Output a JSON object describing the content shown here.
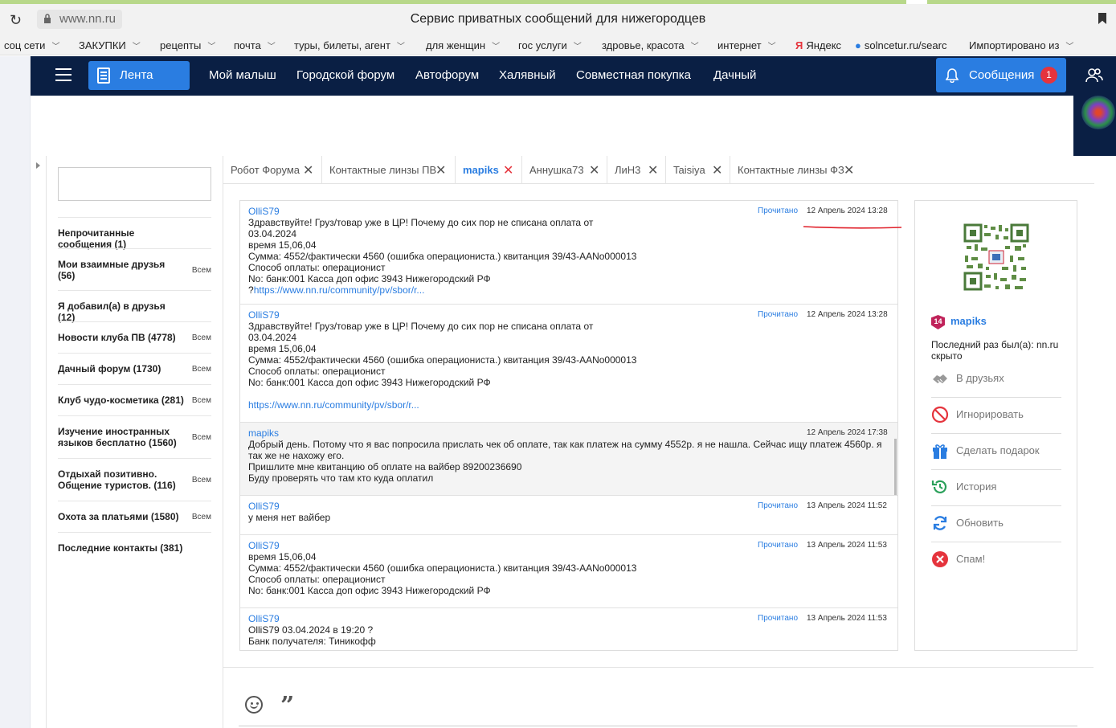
{
  "browser": {
    "url": "www.nn.ru",
    "title": "Сервис приватных сообщений для нижегородцев",
    "bookmarks": [
      {
        "label": "соц сети"
      },
      {
        "label": "ЗАКУПКИ"
      },
      {
        "label": "рецепты"
      },
      {
        "label": "почта"
      },
      {
        "label": "туры, билеты, агент"
      },
      {
        "label": "для женщин"
      },
      {
        "label": "гос услуги"
      },
      {
        "label": "здровье, красота"
      },
      {
        "label": "интернет"
      },
      {
        "label": "Яндекс"
      },
      {
        "label": "solncetur.ru/searc"
      },
      {
        "label": "Импортировано из"
      }
    ]
  },
  "nav": {
    "lenta": "Лента",
    "links": [
      "Мой малыш",
      "Городской форум",
      "Автофорум",
      "Халявный",
      "Совместная покупка",
      "Дачный"
    ],
    "messages_label": "Сообщения",
    "messages_count": "1"
  },
  "sidebar": {
    "search_placeholder": "",
    "items": [
      {
        "label": "Непрочитанные сообщения (1)",
        "all": ""
      },
      {
        "label": "Мои взаимные друзья (56)",
        "all": "Всем"
      },
      {
        "label": "Я добавил(а) в друзья (12)",
        "all": ""
      },
      {
        "label": "Новости клуба ПВ (4778)",
        "all": "Всем"
      },
      {
        "label": "Дачный форум (1730)",
        "all": "Всем"
      },
      {
        "label": "Клуб чудо-косметика (281)",
        "all": "Всем"
      },
      {
        "label": "Изучение иностранных языков бесплатно (1560)",
        "all": "Всем"
      },
      {
        "label": "Отдыхай позитивно. Общение туристов. (116)",
        "all": "Всем"
      },
      {
        "label": "Охота за платьями (1580)",
        "all": "Всем"
      },
      {
        "label": "Последние контакты (381)",
        "all": ""
      }
    ]
  },
  "tabs": [
    {
      "label": "Робот Форума"
    },
    {
      "label": "Контактные линзы ПВ"
    },
    {
      "label": "mapiks"
    },
    {
      "label": "Аннушка73"
    },
    {
      "label": "ЛиН3"
    },
    {
      "label": "Taisiya"
    },
    {
      "label": "Контактные линзы ФЗ"
    }
  ],
  "messages": [
    {
      "author": "OlliS79",
      "status": "Прочитано",
      "date": "12 Апрель 2024 13:28",
      "lines": [
        "Здравствуйте! Груз/товар уже в ЦР! Почему до сих пор не списана оплата от",
        "03.04.2024",
        "время 15,06,04",
        "Сумма: 4552/фактически 4560 (ошибка операциониста.) квитанция 39/43-AANo000013",
        "Способ оплаты: операционист",
        "No: банк:001 Касса доп офис 3943 Нижегородский РФ"
      ],
      "link_prefix": "?",
      "link": "https://www.nn.ru/community/pv/sbor/r..."
    },
    {
      "author": "OlliS79",
      "status": "Прочитано",
      "date": "12 Апрель 2024 13:28",
      "lines": [
        "Здравствуйте! Груз/товар уже в ЦР! Почему до сих пор не списана оплата от",
        "03.04.2024",
        "время 15,06,04",
        "Сумма: 4552/фактически 4560 (ошибка операциониста.) квитанция 39/43-AANo000013",
        "Способ оплаты: операционист",
        "No: банк:001 Касса доп офис 3943 Нижегородский РФ",
        ""
      ],
      "link_prefix": "",
      "link": "https://www.nn.ru/community/pv/sbor/r..."
    },
    {
      "author": "mapiks",
      "status": "",
      "date": "12 Апрель 2024 17:38",
      "lines": [
        "Добрый день. Потому что я вас попросила прислать чек об оплате, так как платеж на сумму 4552р. я не нашла. Сейчас ищу платеж 4560р. я так же не нахожу его.",
        "Пришлите мне квитанцию об оплате на вайбер 89200236690",
        "Буду проверять что там кто куда оплатил"
      ],
      "link_prefix": "",
      "link": ""
    },
    {
      "author": "OlliS79",
      "status": "Прочитано",
      "date": "13 Апрель 2024 11:52",
      "lines": [
        "у меня нет вайбер"
      ],
      "link_prefix": "",
      "link": ""
    },
    {
      "author": "OlliS79",
      "status": "Прочитано",
      "date": "13 Апрель 2024 11:53",
      "lines": [
        "время 15,06,04",
        "Сумма: 4552/фактически 4560 (ошибка операциониста.) квитанция 39/43-AANo000013",
        "Способ оплаты: операционист",
        "No: банк:001 Касса доп офис 3943 Нижегородский РФ"
      ],
      "link_prefix": "",
      "link": ""
    },
    {
      "author": "OlliS79",
      "status": "Прочитано",
      "date": "13 Апрель 2024 11:53",
      "lines": [
        "OlliS79 03.04.2024 в 19:20 ?",
        "Банк получателя: Тиникофф"
      ],
      "link_prefix": "",
      "link": ""
    }
  ],
  "profile": {
    "badge": "14",
    "name": "mapiks",
    "last_seen": "Последний раз был(а): nn.ru скрыто",
    "actions": [
      {
        "label": "В друзьях",
        "icon": "handshake-icon",
        "color": "#888888"
      },
      {
        "label": "Игнорировать",
        "icon": "block-icon",
        "color": "#e5343d"
      },
      {
        "label": "Сделать подарок",
        "icon": "gift-icon",
        "color": "#2a7de1"
      },
      {
        "label": "История",
        "icon": "history-icon",
        "color": "#2aa05a"
      },
      {
        "label": "Обновить",
        "icon": "refresh-icon",
        "color": "#2a7de1"
      },
      {
        "label": "Спам!",
        "icon": "spam-icon",
        "color": "#e5343d"
      }
    ]
  },
  "colors": {
    "navbar": "#0a1f44",
    "accent": "#2a7de1",
    "danger": "#e5343d"
  }
}
